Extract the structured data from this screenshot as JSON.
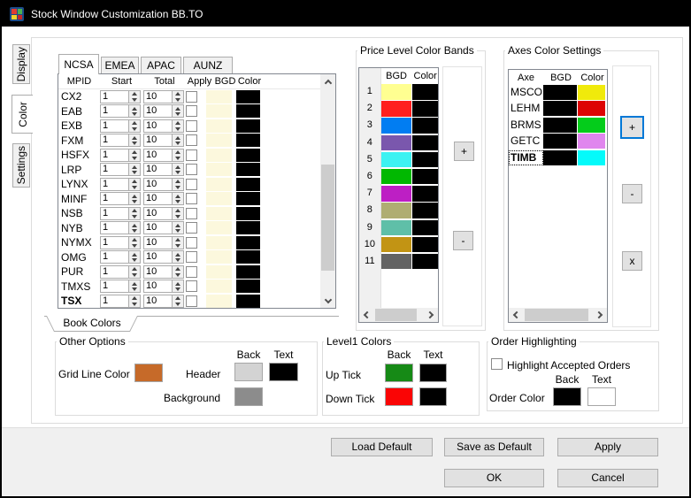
{
  "window": {
    "title": "Stock Window Customization BB.TO",
    "icon": "app-grid-icon"
  },
  "side_tabs": {
    "display": "Display",
    "color": "Color",
    "settings": "Settings",
    "active": "Color"
  },
  "book": {
    "region_tabs": [
      "NCSA",
      "EMEA",
      "APAC",
      "AUNZ"
    ],
    "active_region_tab": "NCSA",
    "columns": [
      "MPID",
      "Start",
      "Total",
      "Apply",
      "BGD",
      "Color"
    ],
    "bottom_tab_label": "Book Colors",
    "rows": [
      {
        "mpid": "CX2",
        "start": "1",
        "total": "10",
        "apply": false,
        "bgd": "#FCF8DD",
        "color": "#000000"
      },
      {
        "mpid": "EAB",
        "start": "1",
        "total": "10",
        "apply": false,
        "bgd": "#FCF8DD",
        "color": "#000000"
      },
      {
        "mpid": "EXB",
        "start": "1",
        "total": "10",
        "apply": false,
        "bgd": "#FCF8DD",
        "color": "#000000"
      },
      {
        "mpid": "FXM",
        "start": "1",
        "total": "10",
        "apply": false,
        "bgd": "#FCF8DD",
        "color": "#000000"
      },
      {
        "mpid": "HSFX",
        "start": "1",
        "total": "10",
        "apply": false,
        "bgd": "#FCF8DD",
        "color": "#000000"
      },
      {
        "mpid": "LRP",
        "start": "1",
        "total": "10",
        "apply": false,
        "bgd": "#FCF8DD",
        "color": "#000000"
      },
      {
        "mpid": "LYNX",
        "start": "1",
        "total": "10",
        "apply": false,
        "bgd": "#FCF8DD",
        "color": "#000000"
      },
      {
        "mpid": "MINF",
        "start": "1",
        "total": "10",
        "apply": false,
        "bgd": "#FCF8DD",
        "color": "#000000"
      },
      {
        "mpid": "NSB",
        "start": "1",
        "total": "10",
        "apply": false,
        "bgd": "#FCF8DD",
        "color": "#000000"
      },
      {
        "mpid": "NYB",
        "start": "1",
        "total": "10",
        "apply": false,
        "bgd": "#FCF8DD",
        "color": "#000000"
      },
      {
        "mpid": "NYMX",
        "start": "1",
        "total": "10",
        "apply": false,
        "bgd": "#FCF8DD",
        "color": "#000000"
      },
      {
        "mpid": "OMG",
        "start": "1",
        "total": "10",
        "apply": false,
        "bgd": "#FCF8DD",
        "color": "#000000"
      },
      {
        "mpid": "PUR",
        "start": "1",
        "total": "10",
        "apply": false,
        "bgd": "#FCF8DD",
        "color": "#000000"
      },
      {
        "mpid": "TMXS",
        "start": "1",
        "total": "10",
        "apply": false,
        "bgd": "#FCF8DD",
        "color": "#000000"
      },
      {
        "mpid": "TSX",
        "start": "1",
        "total": "10",
        "apply": false,
        "bgd": "#FCF8DD",
        "color": "#000000",
        "bold": true
      }
    ]
  },
  "price_bands": {
    "title": "Price Level Color Bands",
    "columns": [
      "BGD",
      "Color"
    ],
    "buttons": {
      "add": "+",
      "remove": "-"
    },
    "rows": [
      {
        "num": "1",
        "bgd": "#FFFF91",
        "color": "#000000"
      },
      {
        "num": "2",
        "bgd": "#FF1F1F",
        "color": "#000000"
      },
      {
        "num": "3",
        "bgd": "#017DF2",
        "color": "#000000"
      },
      {
        "num": "4",
        "bgd": "#7A57AD",
        "color": "#000000"
      },
      {
        "num": "5",
        "bgd": "#3DF2F2",
        "color": "#000000"
      },
      {
        "num": "6",
        "bgd": "#01B801",
        "color": "#000000"
      },
      {
        "num": "7",
        "bgd": "#BD1FC4",
        "color": "#000000"
      },
      {
        "num": "8",
        "bgd": "#AFAD72",
        "color": "#000000"
      },
      {
        "num": "9",
        "bgd": "#5FBFA8",
        "color": "#000000"
      },
      {
        "num": "10",
        "bgd": "#C29414",
        "color": "#000000"
      },
      {
        "num": "11",
        "bgd": "#636363",
        "color": "#000000"
      }
    ]
  },
  "axes": {
    "title": "Axes Color Settings",
    "columns": [
      "Axe",
      "BGD",
      "Color"
    ],
    "buttons": {
      "add": "+",
      "remove": "-",
      "delete": "x"
    },
    "rows": [
      {
        "axe": "MSCO",
        "bgd": "#000000",
        "color": "#F0EA0B"
      },
      {
        "axe": "LEHM",
        "bgd": "#000000",
        "color": "#DD0404"
      },
      {
        "axe": "BRMS",
        "bgd": "#000000",
        "color": "#04CC1B"
      },
      {
        "axe": "GETC",
        "bgd": "#000000",
        "color": "#E086EE"
      },
      {
        "axe": "TIMB",
        "bgd": "#000000",
        "color": "#04FAFA",
        "bold": true,
        "focused": true
      }
    ]
  },
  "other_options": {
    "title": "Other Options",
    "grid_line_label": "Grid Line Color",
    "grid_line_color": "#C66A29",
    "back_header": "Back",
    "text_header": "Text",
    "header_label": "Header",
    "header_back_color": "#D3D3D3",
    "header_text_color": "#000000",
    "background_label": "Background",
    "background_color": "#8C8C8C"
  },
  "level1": {
    "title": "Level1 Colors",
    "back_header": "Back",
    "text_header": "Text",
    "up_label": "Up Tick",
    "up_back": "#168A16",
    "up_text": "#000000",
    "down_label": "Down Tick",
    "down_back": "#FA0505",
    "down_text": "#000000"
  },
  "order_highlighting": {
    "title": "Order Highlighting",
    "checkbox_label": "Highlight Accepted Orders",
    "checked": false,
    "back_header": "Back",
    "text_header": "Text",
    "order_color_label": "Order Color",
    "order_back": "#000000",
    "order_text": "#FFFFFF"
  },
  "footer": {
    "load_default": "Load Default",
    "save_as_default": "Save as Default",
    "apply": "Apply",
    "ok": "OK",
    "cancel": "Cancel"
  }
}
